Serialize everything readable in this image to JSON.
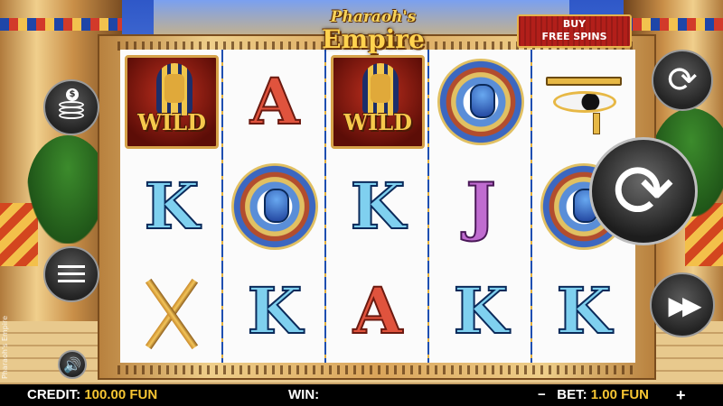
{
  "game": {
    "logo_line1": "Pharaoh's",
    "logo_line2": "Empire",
    "watermark": "Pharaoh's Empire"
  },
  "buy_free_spins": {
    "line1": "BUY",
    "line2": "FREE SPINS"
  },
  "reels": [
    [
      "WILD",
      "K",
      "crook-and-flail"
    ],
    [
      "A",
      "scarab",
      "K"
    ],
    [
      "WILD",
      "K",
      "A"
    ],
    [
      "scarab",
      "J",
      "K"
    ],
    [
      "eye-of-horus",
      "scarab",
      "K"
    ]
  ],
  "wild_label": "WILD",
  "buttons": {
    "coin_symbol": "$",
    "sound_icon": "🔊",
    "autoplay_icon": "⟳",
    "spin_icon": "⟳",
    "fast_forward_icon": "▶▶"
  },
  "bottom_bar": {
    "credit_label": "CREDIT:",
    "credit_value": "100.00 FUN",
    "win_label": "WIN:",
    "minus": "−",
    "bet_label": "BET:",
    "bet_value": "1.00 FUN",
    "plus": "+"
  },
  "colors": {
    "accent_yellow": "#f6c533",
    "frame_gold": "#d9a45a",
    "buy_red": "#b21f1a"
  }
}
